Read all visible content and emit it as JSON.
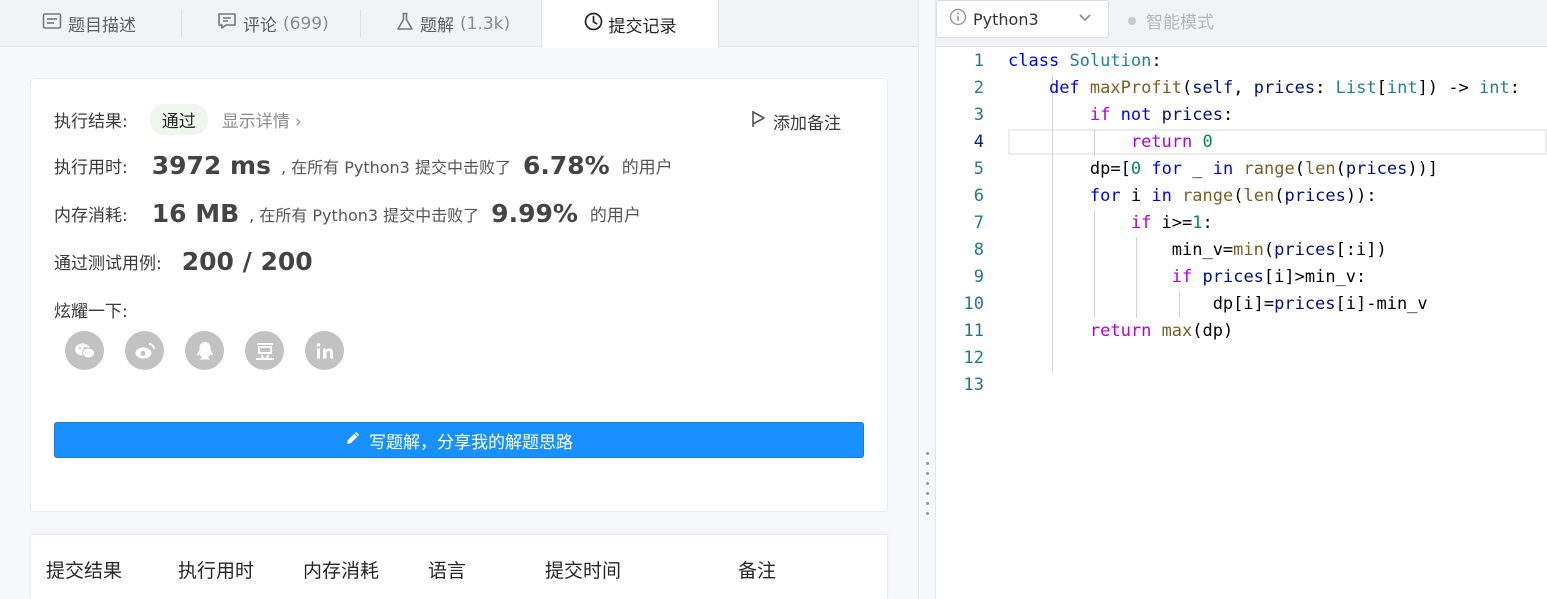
{
  "tabs": [
    {
      "icon": "description-icon",
      "label": "题目描述",
      "count": ""
    },
    {
      "icon": "comment-icon",
      "label": "评论",
      "count": "(699)"
    },
    {
      "icon": "flask-icon",
      "label": "题解",
      "count": "(1.3k)"
    },
    {
      "icon": "clock-icon",
      "label": "提交记录",
      "count": ""
    }
  ],
  "result": {
    "status_label": "执行结果:",
    "status_value": "通过",
    "details_link": "显示详情 ›",
    "add_note": "添加备注",
    "runtime_label": "执行用时:",
    "runtime_value": "3972 ms",
    "runtime_prefix": ", 在所有 Python3 提交中击败了",
    "runtime_pct": "6.78%",
    "runtime_suffix": "的用户",
    "memory_label": "内存消耗:",
    "memory_value": "16 MB",
    "memory_prefix": ", 在所有 Python3 提交中击败了",
    "memory_pct": "9.99%",
    "memory_suffix": "的用户",
    "tests_label": "通过测试用例:",
    "tests_value": "200 / 200",
    "share_label": "炫耀一下:",
    "share_icons": [
      "wechat-icon",
      "weibo-icon",
      "qq-icon",
      "douban-icon",
      "linkedin-icon"
    ],
    "write_button": "写题解，分享我的解题思路"
  },
  "table": {
    "headers": [
      "提交结果",
      "执行用时",
      "内存消耗",
      "语言",
      "提交时间",
      "备注"
    ]
  },
  "editor": {
    "language": "Python3",
    "smart_mode": "智能模式",
    "line_numbers": [
      "1",
      "2",
      "3",
      "4",
      "5",
      "6",
      "7",
      "8",
      "9",
      "10",
      "11",
      "12",
      "13"
    ],
    "code_lines": [
      "class Solution:",
      "    def maxProfit(self, prices: List[int]) -> int:",
      "        if not prices:",
      "            return 0",
      "        dp=[0 for _ in range(len(prices))]",
      "        for i in range(len(prices)):",
      "            if i>=1:",
      "                min_v=min(prices[:i])",
      "                if prices[i]>min_v:",
      "                    dp[i]=prices[i]-min_v",
      "        return max(dp)",
      "",
      ""
    ],
    "current_line": "4"
  }
}
